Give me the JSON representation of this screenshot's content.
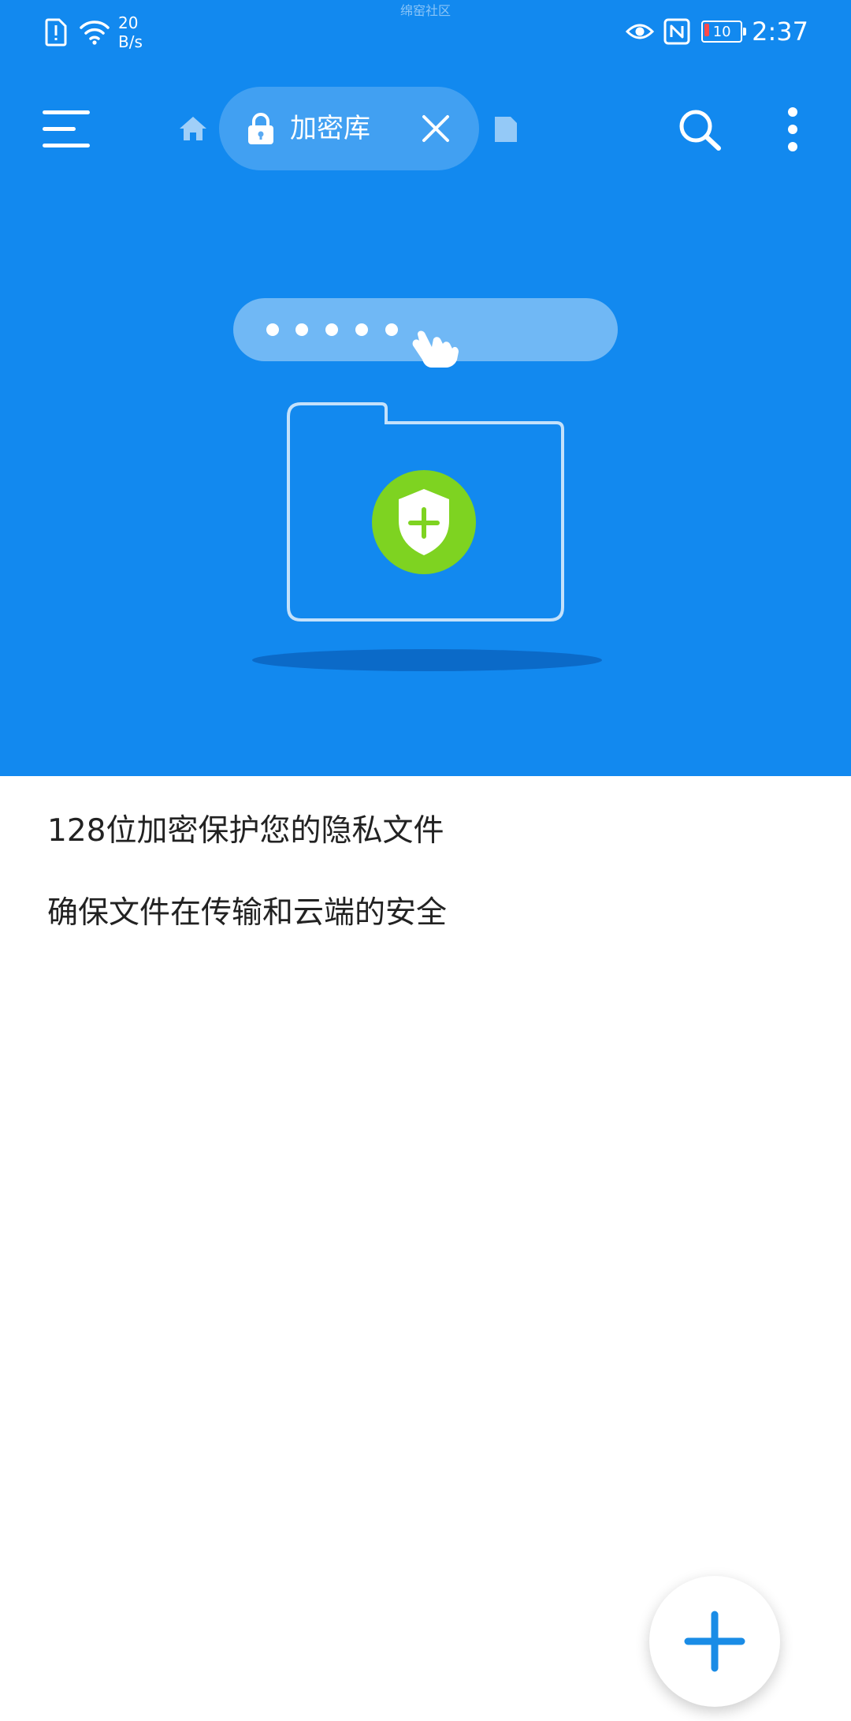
{
  "status_bar": {
    "network_speed_value": "20",
    "network_speed_unit": "B/s",
    "center_watermark": "绵窑社区",
    "battery_level": "10",
    "time": "2:37"
  },
  "toolbar": {
    "tab_label": "加密库"
  },
  "illustration": {
    "password_dots": 5
  },
  "description": {
    "line1": "128位加密保护您的隐私文件",
    "line2": "确保文件在传输和云端的安全"
  },
  "colors": {
    "header_bg": "#1289ef",
    "shield_green": "#7ed321",
    "fab_plus": "#1a8ce6"
  },
  "icons": [
    "sim-alert-icon",
    "wifi-icon",
    "eye-icon",
    "nfc-icon",
    "battery-icon",
    "menu-icon",
    "home-icon",
    "lock-icon",
    "close-icon",
    "document-icon",
    "search-icon",
    "more-vert-icon",
    "pointer-hand-icon",
    "folder-icon",
    "shield-plus-icon",
    "plus-icon"
  ]
}
